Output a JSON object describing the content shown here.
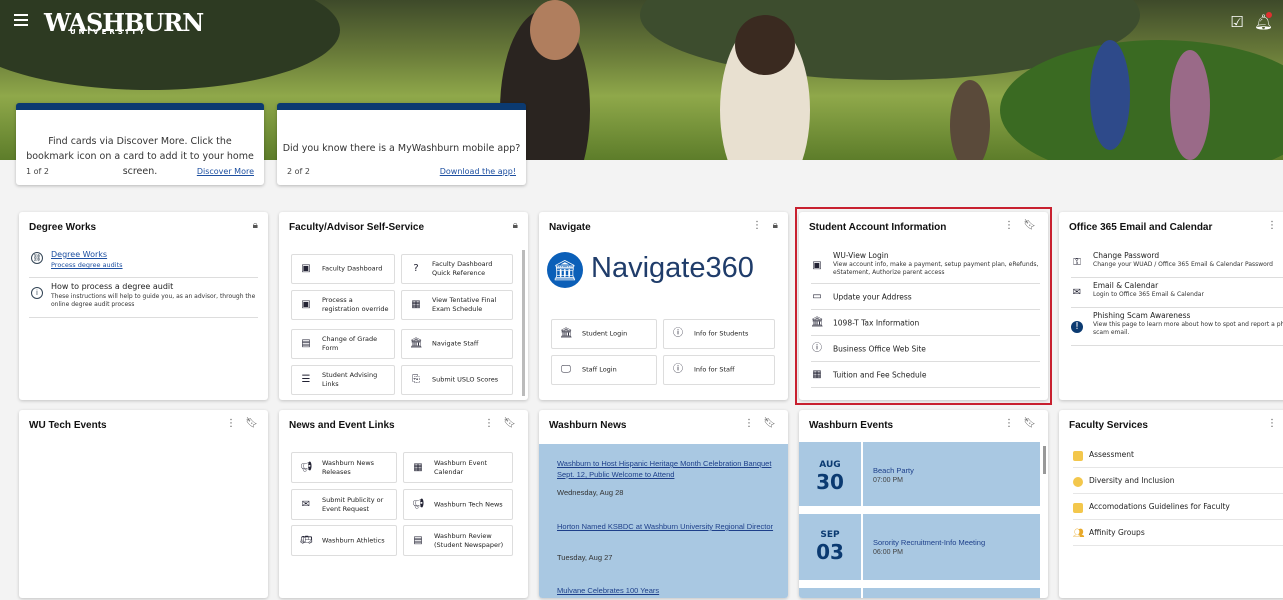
{
  "brand": {
    "logo": "WASHBURN",
    "sub": "UNIVERSITY"
  },
  "topbar": {
    "menu_icon": "hamburger-icon",
    "tasks_icon": "tasks-icon",
    "bell_icon": "bell-icon"
  },
  "promo": [
    {
      "text": "Find cards via Discover More. Click the bookmark icon on a card to add it to your home screen.",
      "num": "1 of 2",
      "link": "Discover More"
    },
    {
      "text": "Did you know there is a MyWashburn mobile app?",
      "num": "2 of 2",
      "link": "Download the app!"
    }
  ],
  "degree_works": {
    "title": "Degree Works",
    "items": [
      {
        "title": "Degree Works",
        "sub": "Process degree audits"
      },
      {
        "title": "How to process a degree audit",
        "sub": "These instructions will help to guide you, as an advisor, through the online degree audit process"
      }
    ]
  },
  "faculty": {
    "title": "Faculty/Advisor Self-Service",
    "tiles": [
      "Faculty Dashboard",
      "Faculty Dashboard Quick Reference",
      "Process a registration override",
      "View Tentative Final Exam Schedule",
      "Change of Grade Form",
      "Navigate Staff",
      "Student Advising Links",
      "Submit USLO Scores"
    ]
  },
  "navigate": {
    "title": "Navigate",
    "logo": "Navigate360",
    "tiles": [
      "Student Login",
      "Info for Students",
      "Staff Login",
      "Info for Staff"
    ]
  },
  "student_account": {
    "title": "Student Account Information",
    "first_title": "WU-View Login",
    "first_sub": "View account info, make a payment, setup payment plan, eRefunds, eStatement, Authorize parent access",
    "items": [
      "Update your Address",
      "1098-T Tax Information",
      "Business Office Web Site",
      "Tuition and Fee Schedule"
    ]
  },
  "office365": {
    "title": "Office 365 Email and Calendar",
    "items": [
      {
        "title": "Change Password",
        "sub": "Change your WUAD / Office 365 Email & Calendar Password"
      },
      {
        "title": "Email & Calendar",
        "sub": "Login to Office 365 Email & Calendar"
      },
      {
        "title": "Phishing Scam Awareness",
        "sub": "View this page to learn more about how to spot and report a phishing scam email."
      }
    ]
  },
  "tech_events": {
    "title": "WU Tech Events"
  },
  "news_links": {
    "title": "News and Event Links",
    "tiles": [
      "Washburn News Releases",
      "Washburn Event Calendar",
      "Submit Publicity or Event Request",
      "Washburn Tech News",
      "Washburn Athletics",
      "Washburn Review (Student Newspaper)"
    ]
  },
  "wash_news": {
    "title": "Washburn News",
    "items": [
      {
        "headline": "Washburn to Host Hispanic Heritage Month Celebration Banquet Sept. 12, Public Welcome to Attend",
        "date": "Wednesday, Aug 28"
      },
      {
        "headline": "Horton Named KSBDC at Washburn University Regional Director",
        "date": "Tuesday, Aug 27"
      },
      {
        "headline": "Mulvane Celebrates 100 Years",
        "date": ""
      }
    ]
  },
  "wash_events": {
    "title": "Washburn Events",
    "items": [
      {
        "month": "AUG",
        "day": "30",
        "name": "Beach Party",
        "time": "07:00 PM"
      },
      {
        "month": "SEP",
        "day": "03",
        "name": "Sorority Recruitment-Info Meeting",
        "time": "06:00 PM"
      }
    ]
  },
  "faculty_services": {
    "title": "Faculty Services",
    "items": [
      "Assessment",
      "Diversity and Inclusion",
      "Accomodations Guidelines for Faculty",
      "Affinity Groups"
    ]
  },
  "colors": {
    "navy": "#0b3a71",
    "highlight": "#c8202f",
    "news_bg": "#a9c8e2"
  }
}
